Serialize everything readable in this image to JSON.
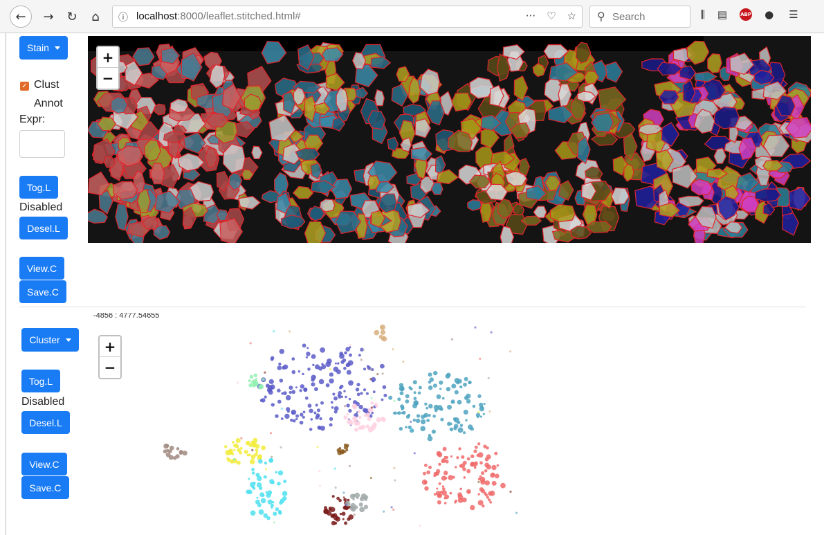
{
  "browser": {
    "url_host": "localhost",
    "url_rest": ":8000/leaflet.stitched.html#",
    "search_placeholder": "Search",
    "page_actions": "···"
  },
  "top_panel": {
    "stain_button": "Stain",
    "clust_label": "Clust",
    "annot_label": "Annot",
    "expr_label": "Expr:",
    "tog_button": "Tog.L",
    "disabled_label": "Disabled",
    "desel_button": "Desel.L",
    "view_button": "View.C",
    "save_button": "Save.C"
  },
  "bottom_panel": {
    "cluster_button": "Cluster",
    "tog_button": "Tog.L",
    "disabled_label": "Disabled",
    "desel_button": "Desel.L",
    "view_button": "View.C",
    "save_button": "Save.C",
    "coord_readout": "-4856 : 4777.54655"
  },
  "zoom": {
    "in": "+",
    "out": "−"
  },
  "colors": {
    "button": "#1a7cf5",
    "cell_outline": "#e0242b",
    "cluster_colors": [
      "#5a5ac8",
      "#4fa3c0",
      "#f06a6a",
      "#f2ec3a",
      "#4fe0f0",
      "#7a1a1a",
      "#8b5a1e",
      "#a0a8a8",
      "#ffd0e0",
      "#90f0b0",
      "#a08880",
      "#d8b080"
    ]
  }
}
